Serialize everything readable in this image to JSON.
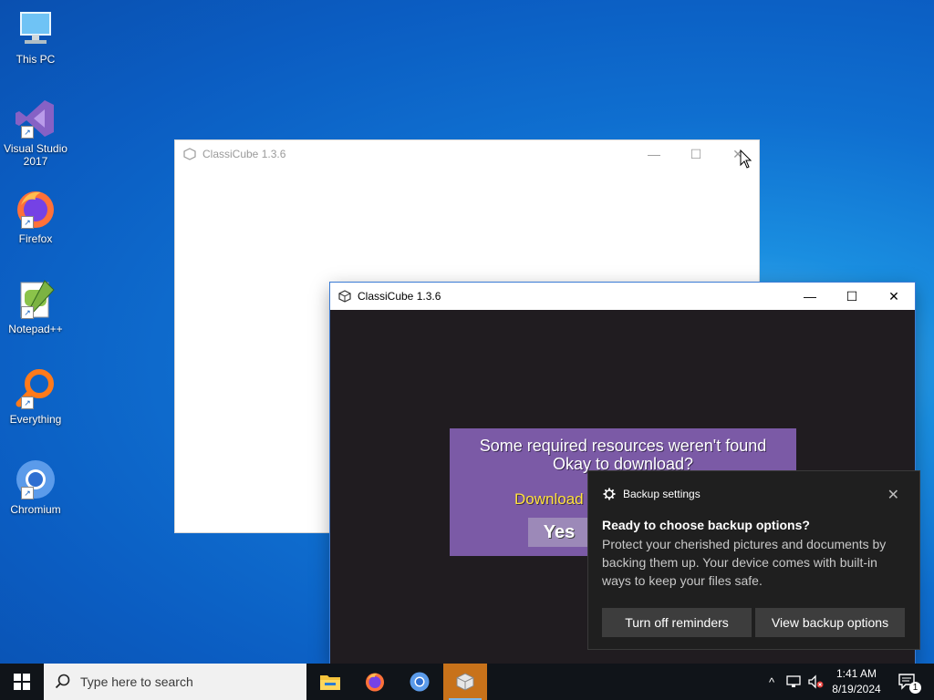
{
  "desktop": {
    "icons": [
      {
        "label_1": "This PC",
        "label_2": ""
      },
      {
        "label_1": "Visual Studio",
        "label_2": "2017"
      },
      {
        "label_1": "Firefox",
        "label_2": ""
      },
      {
        "label_1": "Notepad++",
        "label_2": ""
      },
      {
        "label_1": "Everything",
        "label_2": ""
      },
      {
        "label_1": "Chromium",
        "label_2": ""
      }
    ]
  },
  "window_back": {
    "title": "ClassiCube 1.3.6",
    "minimize": "—",
    "maximize": "☐",
    "close": "✕"
  },
  "window_front": {
    "title": "ClassiCube 1.3.6",
    "minimize": "—",
    "maximize": "☐",
    "close": "✕",
    "dialog": {
      "line1": "Some required resources weren't found",
      "line2": "Okay to download?",
      "download_partial": "Download s",
      "yes_label": "Yes"
    }
  },
  "toast": {
    "app_name": "Backup settings",
    "close": "✕",
    "heading": "Ready to choose backup options?",
    "body": "Protect your cherished pictures and documents by backing them up. Your device comes with built-in ways to keep your files safe.",
    "button_1": "Turn off reminders",
    "button_2": "View backup options"
  },
  "taskbar": {
    "search_placeholder": "Type here to search",
    "apps": [
      "file-explorer-icon",
      "firefox-icon",
      "chromium-icon",
      "classicube-icon"
    ],
    "tray_chevron": "^",
    "time": "1:41 AM",
    "date": "8/19/2024",
    "notification_count": "1"
  },
  "colors": {
    "dialog_bg": "#7b5aa6",
    "download_text": "#ffe23a",
    "active_app": "#c8721a",
    "toast_bg": "#1f1f1f"
  }
}
